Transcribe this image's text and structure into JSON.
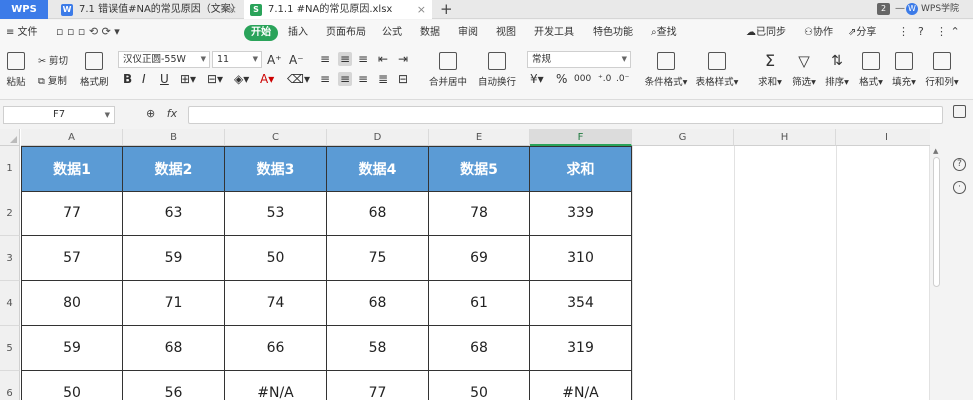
{
  "app": {
    "brand": "WPS",
    "tabs": [
      {
        "icon": "W",
        "title": "7.1 错误值#NA的常见原因（文案）",
        "icon_color": "#3c7be8",
        "close": "×"
      },
      {
        "icon": "S",
        "title": "7.1.1 #NA的常见原因.xlsx",
        "icon_color": "#2aa35a",
        "close": "×"
      }
    ],
    "add_tab": "+",
    "window_badge": "2",
    "school_label": "WPS学院"
  },
  "menu": {
    "file": "≡ 文件",
    "items": [
      "开始",
      "插入",
      "页面布局",
      "公式",
      "数据",
      "审阅",
      "视图",
      "开发工具",
      "特色功能"
    ],
    "search": "查找",
    "sync": "已同步",
    "collab": "协作",
    "share": "分享"
  },
  "ribbon": {
    "paste": "粘贴",
    "cut": "剪切",
    "copy": "复制",
    "format_painter": "格式刷",
    "font_name": "汉仪正圆-55W",
    "font_size": "11",
    "merge_center": "合并居中",
    "wrap_text": "自动换行",
    "number_format": "常规",
    "conditional_format": "条件格式",
    "table_style": "表格样式",
    "sum": "求和",
    "filter": "筛选",
    "sort": "排序",
    "format": "格式",
    "fill": "填充",
    "row_col": "行和列",
    "bold": "B",
    "italic": "I",
    "underline": "U",
    "percent": "%",
    "currency": "¥"
  },
  "formula_bar": {
    "name_box": "F7",
    "fx": "fx",
    "content": ""
  },
  "sheet": {
    "columns": [
      "A",
      "B",
      "C",
      "D",
      "E",
      "F",
      "G",
      "H",
      "I"
    ],
    "active_column": "F",
    "rows": [
      "1",
      "2",
      "3",
      "4",
      "5",
      "6"
    ],
    "header": [
      "数据1",
      "数据2",
      "数据3",
      "数据4",
      "数据5",
      "求和"
    ],
    "data": [
      [
        "77",
        "63",
        "53",
        "68",
        "78",
        "339"
      ],
      [
        "57",
        "59",
        "50",
        "75",
        "69",
        "310"
      ],
      [
        "80",
        "71",
        "74",
        "68",
        "61",
        "354"
      ],
      [
        "59",
        "68",
        "66",
        "58",
        "68",
        "319"
      ],
      [
        "50",
        "56",
        "#N/A",
        "77",
        "50",
        "#N/A"
      ]
    ],
    "header_color": "#5b9bd5"
  }
}
